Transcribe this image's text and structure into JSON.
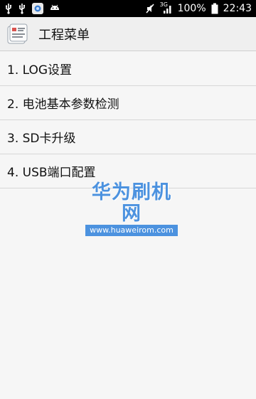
{
  "status_bar": {
    "left_icons": [
      "usb-icon",
      "usb-icon",
      "gallery-notification-icon",
      "android-icon"
    ],
    "right_icons": [
      "mute-icon",
      "signal-3g-icon",
      "battery-icon"
    ],
    "network_type": "3G",
    "battery": "100%",
    "time": "22:43"
  },
  "action_bar": {
    "title": "工程菜单",
    "icon": "engineering-menu-icon"
  },
  "menu": {
    "items": [
      {
        "label": "1. LOG设置"
      },
      {
        "label": "2. 电池基本参数检测"
      },
      {
        "label": "3. SD卡升级"
      },
      {
        "label": "4. USB端口配置"
      }
    ]
  },
  "watermark": {
    "title": "华为刷机网",
    "url": "www.huaweirom.com"
  },
  "colors": {
    "status_bar_bg": "#000000",
    "action_bar_bg": "#efefef",
    "background": "#f6f6f6",
    "watermark": "#4c92df"
  }
}
